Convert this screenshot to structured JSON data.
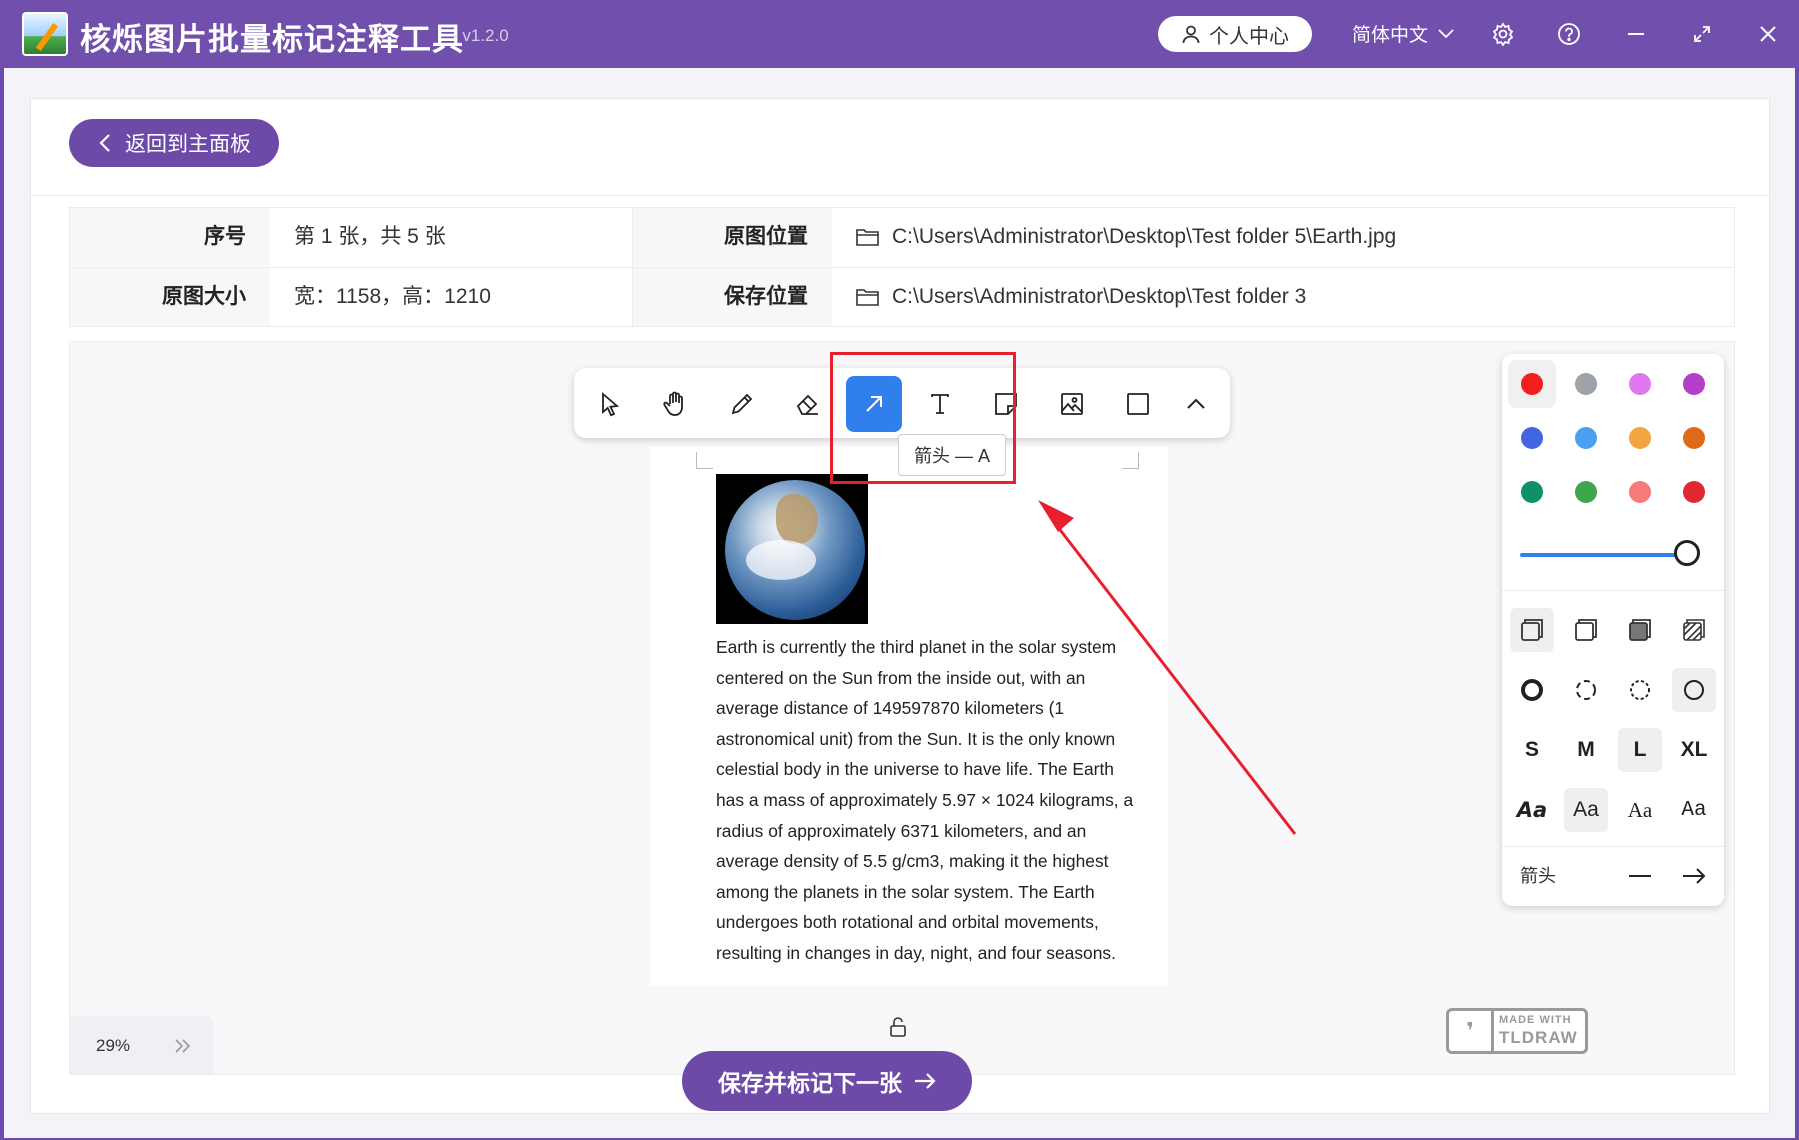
{
  "app": {
    "title": "核烁图片批量标记注释工具",
    "version": "- v1.2.0"
  },
  "header": {
    "user_center": "个人中心",
    "language": "简体中文"
  },
  "nav": {
    "back_label": "返回到主面板"
  },
  "info": {
    "index_label": "序号",
    "index_value": "第 1 张，共 5 张",
    "orig_path_label": "原图位置",
    "orig_path_value": "C:\\Users\\Administrator\\Desktop\\Test folder 5\\Earth.jpg",
    "size_label": "原图大小",
    "size_value": "宽：1158，高：1210",
    "save_path_label": "保存位置",
    "save_path_value": "C:\\Users\\Administrator\\Desktop\\Test folder 3"
  },
  "toolbar": {
    "tools": [
      "select-tool",
      "hand-tool",
      "draw-tool",
      "eraser-tool",
      "arrow-tool",
      "text-tool",
      "note-tool",
      "image-tool",
      "rectangle-tool",
      "more-tool"
    ],
    "active_tool": "arrow-tool",
    "tooltip": "箭头 — A"
  },
  "document": {
    "text": "Earth is currently the third planet in the solar system centered on the Sun from the inside out, with an average distance of 149597870 kilometers (1 astronomical unit) from the Sun. It is the only known celestial body in the universe to have life. The Earth has a mass of approximately 5.97 × 1024 kilograms, a radius of approximately 6371 kilometers, and an average density of 5.5 g/cm3, making it the highest among the planets in the solar system. The Earth undergoes both rotational and orbital movements, resulting in changes in day, night, and four seasons."
  },
  "style_panel": {
    "colors": [
      "#f21d1d",
      "#9ea3aa",
      "#e078ef",
      "#b33ec9",
      "#4463e3",
      "#4aa0f0",
      "#f2a63d",
      "#e16a1a",
      "#0f8f6a",
      "#3ea54c",
      "#f67a7a",
      "#e0292e"
    ],
    "selected_color": "#f21d1d",
    "opacity_percent": 100,
    "sizes": [
      "S",
      "M",
      "L",
      "XL"
    ],
    "selected_size": "L",
    "fonts": [
      "Aa",
      "Aa",
      "Aa",
      "Aa"
    ],
    "selected_font_index": 1,
    "arrowhead_label": "箭头"
  },
  "canvas": {
    "zoom": "29%"
  },
  "footer": {
    "save_next_label": "保存并标记下一张"
  },
  "watermark": {
    "line1": "MADE WITH",
    "line2": "TLDRAW"
  }
}
